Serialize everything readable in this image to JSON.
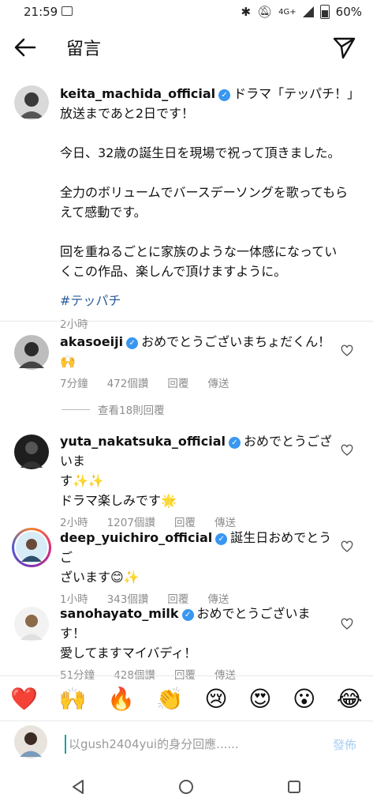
{
  "status": {
    "time": "21:59",
    "network": "4G+",
    "battery": "60%"
  },
  "header": {
    "title": "留言"
  },
  "post": {
    "username": "keita_machida_official",
    "text_line1": "ドラマ「テッパチ！」",
    "text_line2": "放送まであと2日です！",
    "para1": "今日、32歳の誕生日を現場で祝って頂きました。",
    "para2_l1": "全力のボリュームでバースデーソングを歌ってもら",
    "para2_l2": "えて感動です。",
    "para3_l1": "回を重ねるごとに家族のような一体感になってい",
    "para3_l2": "くこの作品、楽しんで頂けますように。",
    "hashtag": "#テッパチ",
    "time": "2小時"
  },
  "comments": [
    {
      "username": "akasoeiji",
      "text_l1": "おめでとうございまちょだくん！",
      "text_l2": "🙌",
      "time": "7分鐘",
      "likes": "472個讚",
      "reply": "回覆",
      "send": "傳送"
    },
    {
      "username": "yuta_nakatsuka_official",
      "text_l1": "おめでとうございま",
      "text_l2": "す✨✨",
      "text_l3": "ドラマ楽しみです🌟",
      "time": "2小時",
      "likes": "1207個讚",
      "reply": "回覆",
      "send": "傳送"
    },
    {
      "username": "deep_yuichiro_official",
      "text_l1": "誕生日おめでとうご",
      "text_l2": "ざいます😊✨",
      "time": "1小時",
      "likes": "343個讚",
      "reply": "回覆",
      "send": "傳送"
    },
    {
      "username": "sanohayato_milk",
      "text_l1": "おめでとうございます！",
      "text_l2": "愛してますマイバディ！",
      "time": "51分鐘",
      "likes": "428個讚",
      "reply": "回覆",
      "send": "傳送"
    }
  ],
  "view_replies": "查看18則回覆",
  "emoji_bar": [
    "❤️",
    "🙌",
    "🔥",
    "👏",
    "😢",
    "😍",
    "😮",
    "😂"
  ],
  "input": {
    "placeholder": "以gush2404yui的身分回應......",
    "post_label": "發佈"
  },
  "colors": {
    "verified": "#3897f0",
    "post_disabled": "#a7cdf3",
    "meta": "#8e8e8e"
  }
}
